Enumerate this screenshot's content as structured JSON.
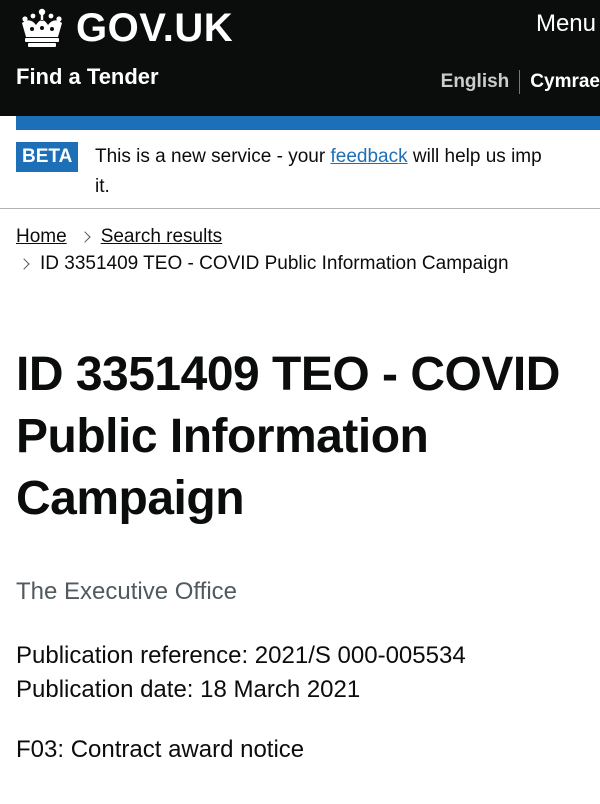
{
  "header": {
    "logo_text": "GOV.UK",
    "menu_label": "Menu",
    "service_name": "Find a Tender",
    "languages": {
      "english": "English",
      "welsh": "Cymrae"
    }
  },
  "beta": {
    "tag": "BETA",
    "text_before": "This is a new service - your ",
    "link": "feedback",
    "text_after": " will help us imp",
    "line2": "it."
  },
  "breadcrumb": {
    "home": "Home",
    "search": "Search results",
    "current": "ID 3351409 TEO - COVID Public Information Campaign"
  },
  "page": {
    "title": "ID 3351409 TEO - COVID Public Information Campaign",
    "organisation": "The Executive Office",
    "publication_reference": "Publication reference: 2021/S 000-005534",
    "publication_date": "Publication date: 18 March 2021",
    "notice_type": "F03: Contract award notice"
  },
  "colors": {
    "header_bg": "#0b0c0c",
    "accent_blue": "#1d70b8",
    "secondary_text": "#505a5f"
  },
  "icons": {
    "logo": "crown-icon",
    "breadcrumb_separator": "chevron-right-icon"
  }
}
